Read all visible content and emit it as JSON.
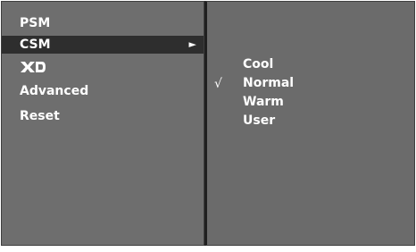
{
  "menu": {
    "items": [
      {
        "label": "PSM"
      },
      {
        "label": "CSM"
      },
      {
        "label": "XD"
      },
      {
        "label": "Advanced"
      },
      {
        "label": "Reset"
      }
    ],
    "selected_arrow": "►"
  },
  "submenu": {
    "items": [
      {
        "label": "Cool"
      },
      {
        "label": "Normal"
      },
      {
        "label": "Warm"
      },
      {
        "label": "User"
      }
    ],
    "check_mark": "√"
  },
  "colors": {
    "panel": "#6e6e6e",
    "selected": "#2e2e2e",
    "text": "#ffffff"
  }
}
